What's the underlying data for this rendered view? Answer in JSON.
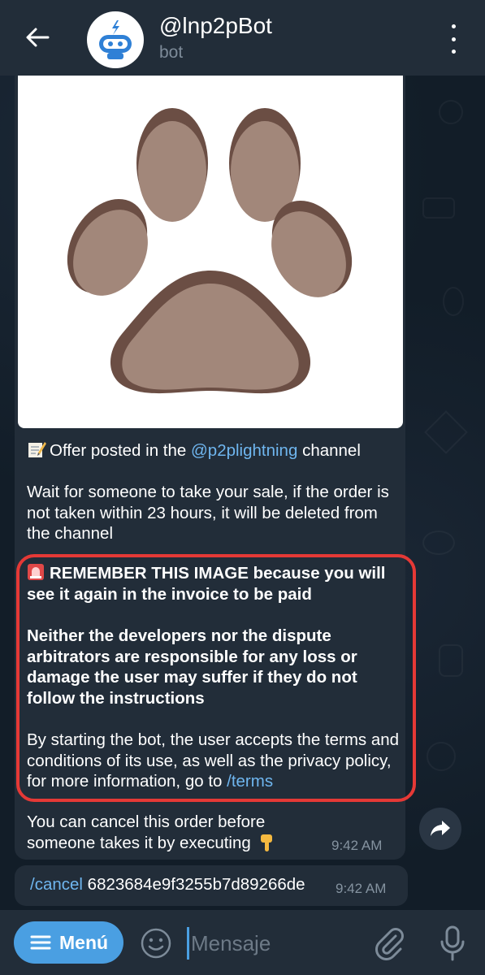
{
  "header": {
    "title": "@lnp2pBot",
    "subtitle": "bot"
  },
  "message": {
    "offer_prefix": "Offer posted in the ",
    "offer_link": "@p2plightning",
    "offer_suffix": " channel",
    "wait_text": "Wait for someone to take your sale, if the order is not taken within 23 hours, it will be deleted from the channel",
    "remember_text": "REMEMBER THIS IMAGE because you will see it again in the invoice to be paid",
    "disclaimer_text": "Neither the developers nor the dispute arbitrators are responsible for any loss or damage the user may suffer if they do not follow the instructions",
    "terms_prefix": "By starting the bot, the user accepts the terms and conditions of its use, as well as the privacy policy, for more information, go to ",
    "terms_link": "/terms",
    "cancel_text": "You can cancel this order before someone takes it by executing",
    "time": "9:42 AM"
  },
  "message2": {
    "command": "/cancel",
    "order_id": " 6823684e9f3255b7d89266de",
    "time": "9:42 AM"
  },
  "input_bar": {
    "menu_label": "Menú",
    "placeholder": "Mensaje"
  },
  "colors": {
    "accent": "#4a9fe2",
    "link": "#6fb6ef",
    "highlight": "#e53936",
    "bubble": "#222d39"
  },
  "icons": [
    "back-arrow-icon",
    "bot-avatar-icon",
    "more-vert-icon",
    "memo-icon",
    "siren-icon",
    "pointing-down-icon",
    "share-icon",
    "hamburger-icon",
    "emoji-icon",
    "paperclip-icon",
    "microphone-icon",
    "paw-image"
  ]
}
